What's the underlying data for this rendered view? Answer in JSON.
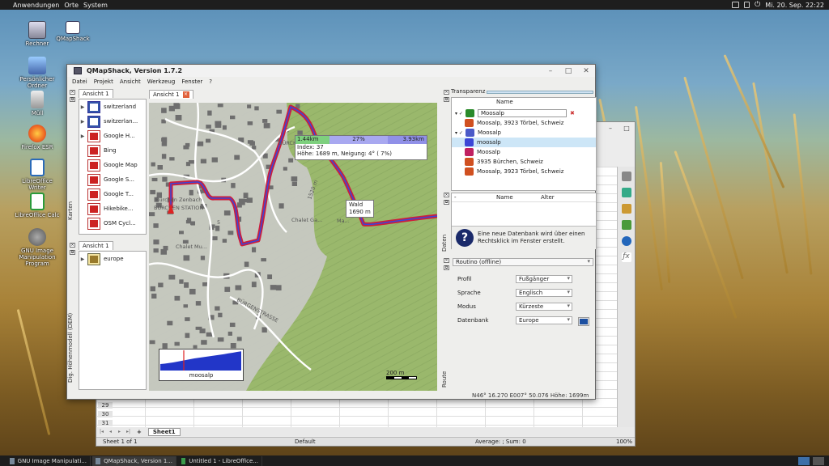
{
  "top_panel": {
    "menus": [
      "Anwendungen",
      "Orte",
      "System"
    ],
    "clock": "Mi. 20. Sep. 22:22"
  },
  "desktop_icons": [
    {
      "label": "Rechner",
      "icon": "computer-icon"
    },
    {
      "label": "QMapShack",
      "icon": "qmapshack-icon"
    },
    {
      "label": "Persönlicher Ordner",
      "icon": "home-folder-icon"
    },
    {
      "label": "Müll",
      "icon": "trash-icon"
    },
    {
      "label": "Firefox ESR",
      "icon": "firefox-icon"
    },
    {
      "label": "LibreOffice Writer",
      "icon": "writer-icon"
    },
    {
      "label": "LibreOffice Calc",
      "icon": "calc-icon"
    },
    {
      "label": "GNU Image Manipulation Program",
      "icon": "gimp-icon"
    }
  ],
  "libreoffice": {
    "rows": [
      "29",
      "30",
      "31"
    ],
    "sheet_tab": "Sheet1",
    "status_sheet": "Sheet 1 of 1",
    "status_style": "Default",
    "status_sum": "Average: ; Sum: 0",
    "zoom": "100%"
  },
  "qmapshack": {
    "title": "QMapShack, Version 1.7.2",
    "menu": [
      "Datei",
      "Projekt",
      "Ansicht",
      "Werkzeug",
      "Fenster",
      "?"
    ],
    "maps_dock": {
      "tab": "Ansicht 1",
      "side_label": "Karten",
      "items": [
        "switzerland",
        "switzerlan...",
        "Google H...",
        "Bing",
        "Google Map",
        "Google S...",
        "Google T...",
        "Hikebike...",
        "OSM Cycl..."
      ]
    },
    "dem_dock": {
      "tab": "Ansicht 1",
      "side_label": "Dig. Höhenmodell (DEM)",
      "items": [
        "europe"
      ]
    },
    "map_tab": "Ansicht 1",
    "map": {
      "labels": [
        "BÜRCHEN, PAS...",
        "Bürchen Zenbach",
        "BÜRCHEN STATION",
        "Chalet Ga...",
        "Chalet Mu...",
        "BÜRGENSTRASSE",
        "1520 m",
        "Ma...",
        "5"
      ],
      "info": {
        "seg1": "1.44km",
        "seg2": "27%",
        "seg3": "3.93km",
        "line1": "Index: 37",
        "line2": "Höhe: 1689 m, Neigung:  4° ( 7%)"
      },
      "wald": {
        "line1": "Wald",
        "line2": "1690 m"
      },
      "profile_label": "moosalp",
      "profile": [
        0.32,
        0.34,
        0.37,
        0.4,
        0.44,
        0.48,
        0.52,
        0.56,
        0.6,
        0.63,
        0.66,
        0.69,
        0.72,
        0.75,
        0.78,
        0.81,
        0.85,
        0.88,
        0.92,
        0.95
      ],
      "scale": "200 m"
    },
    "transparency_label": "Transparenz",
    "workspace": {
      "header": "Name",
      "rows": [
        {
          "label": "Moosalp",
          "icon": "search-icon",
          "editable": true
        },
        {
          "label": "Moosalp, 3923 Törbel, Schweiz",
          "icon": "search-result-icon"
        },
        {
          "label": "Moosalp",
          "icon": "project-icon"
        },
        {
          "label": "moosalp",
          "icon": "track-icon",
          "selected": true
        },
        {
          "label": "Moosalp",
          "icon": "route-icon"
        },
        {
          "label": "3935 Bürchen, Schweiz",
          "icon": "search-result-icon"
        },
        {
          "label": "Moosalp, 3923 Törbel, Schweiz",
          "icon": "search-result-icon"
        }
      ]
    },
    "database": {
      "columns": [
        "-",
        "Name",
        "Alter"
      ],
      "side_label": "Daten",
      "help": "Eine neue Datenbank wird über einen Rechtsklick im Fenster erstellt."
    },
    "route": {
      "side_label": "Route",
      "router": "Routino (offline)",
      "fields": [
        {
          "label": "Profil",
          "value": "Fußgänger"
        },
        {
          "label": "Sprache",
          "value": "Englisch"
        },
        {
          "label": "Modus",
          "value": "Kürzeste"
        },
        {
          "label": "Datenbank",
          "value": "Europe"
        }
      ]
    },
    "status": "N46° 16.270 E007° 50.076 Höhe: 1699m"
  },
  "taskbar": [
    {
      "label": "GNU Image Manipulati...",
      "active": false
    },
    {
      "label": "QMapShack, Version 1...",
      "active": true
    },
    {
      "label": "Untitled 1 - LibreOffice...",
      "active": false
    }
  ],
  "colors": {
    "track": "#cc1e3c",
    "track_inner": "#3b46d6",
    "map_green": "#9ab86c",
    "map_gray": "#c8c8c4",
    "selected": "#cde6f7"
  }
}
